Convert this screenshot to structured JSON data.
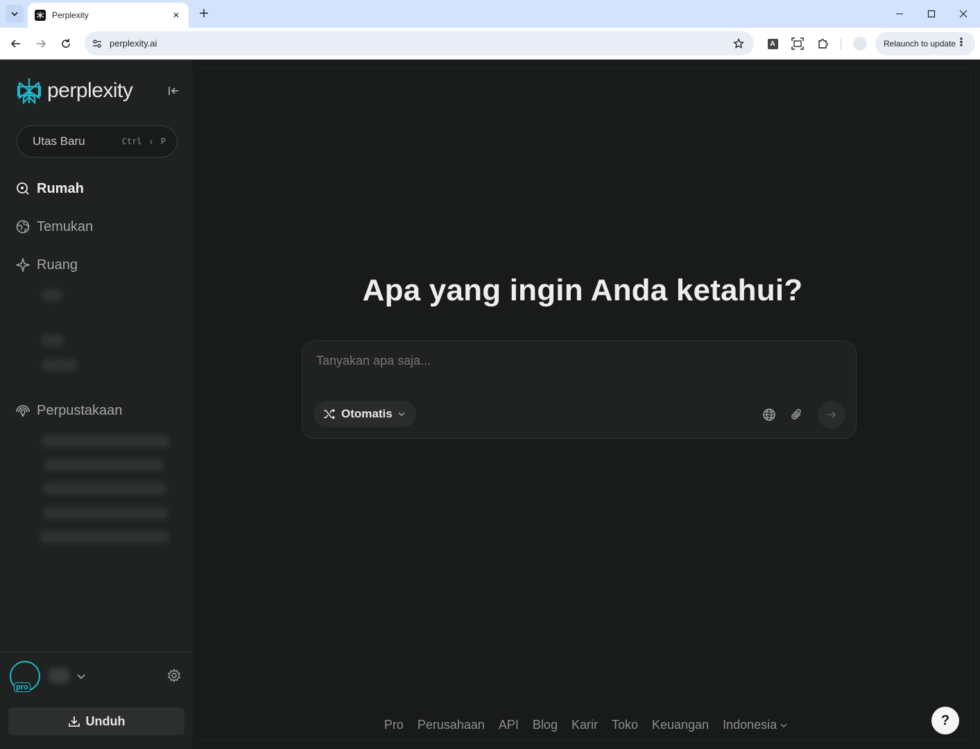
{
  "browser": {
    "tab_title": "Perplexity",
    "url": "perplexity.ai",
    "relaunch_label": "Relaunch to update",
    "translate_badge": "A"
  },
  "sidebar": {
    "logo_text": "perplexity",
    "new_thread": {
      "label": "Utas Baru",
      "shortcut": [
        "Ctrl",
        "⇧",
        "P"
      ]
    },
    "nav": [
      {
        "label": "Rumah",
        "icon": "search-icon",
        "active": true
      },
      {
        "label": "Temukan",
        "icon": "globe-icon"
      },
      {
        "label": "Ruang",
        "icon": "sparkle-icon"
      },
      {
        "label": "Perpustakaan",
        "icon": "library-icon"
      }
    ],
    "pro_badge": "pro",
    "download_label": "Unduh"
  },
  "main": {
    "headline": "Apa yang ingin Anda ketahui?",
    "ask_placeholder": "Tanyakan apa saja...",
    "mode_label": "Otomatis",
    "footer_links": [
      "Pro",
      "Perusahaan",
      "API",
      "Blog",
      "Karir",
      "Toko",
      "Keuangan"
    ],
    "language": "Indonesia",
    "help_label": "?"
  },
  "colors": {
    "accent": "#20b8cd",
    "background": "#191a1a",
    "sidebar": "#202222"
  }
}
